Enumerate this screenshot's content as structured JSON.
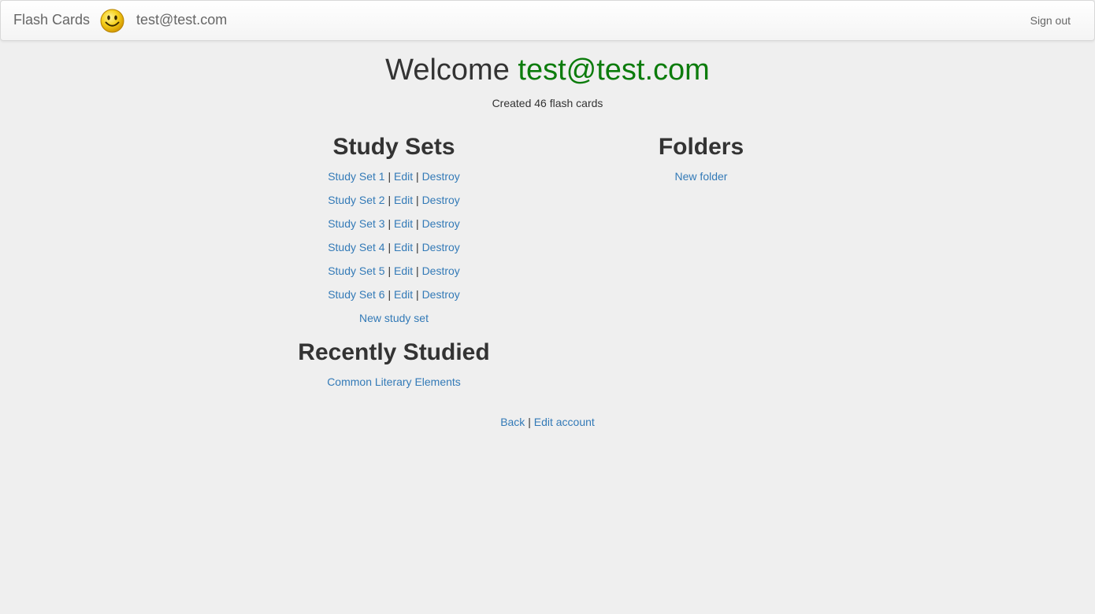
{
  "navbar": {
    "brand": "Flash Cards",
    "user_email": "test@test.com",
    "sign_out": "Sign out"
  },
  "welcome": {
    "prefix": "Welcome",
    "email": "test@test.com",
    "created_text": "Created 46 flash cards"
  },
  "study_sets": {
    "title": "Study Sets",
    "items": [
      {
        "name": "Study Set 1",
        "edit": "Edit",
        "destroy": "Destroy"
      },
      {
        "name": "Study Set 2",
        "edit": "Edit",
        "destroy": "Destroy"
      },
      {
        "name": "Study Set 3",
        "edit": "Edit",
        "destroy": "Destroy"
      },
      {
        "name": "Study Set 4",
        "edit": "Edit",
        "destroy": "Destroy"
      },
      {
        "name": "Study Set 5",
        "edit": "Edit",
        "destroy": "Destroy"
      },
      {
        "name": "Study Set 6",
        "edit": "Edit",
        "destroy": "Destroy"
      }
    ],
    "new_link": "New study set",
    "separator": "|"
  },
  "folders": {
    "title": "Folders",
    "new_link": "New folder"
  },
  "recently_studied": {
    "title": "Recently Studied",
    "items": [
      "Common Literary Elements"
    ]
  },
  "footer": {
    "back": "Back",
    "edit_account": "Edit account",
    "separator": "|"
  },
  "colors": {
    "link": "#337ab7",
    "welcome_email": "#0c7c0c",
    "background": "#efefef"
  },
  "icons": {
    "avatar": "smiley-face-icon"
  }
}
